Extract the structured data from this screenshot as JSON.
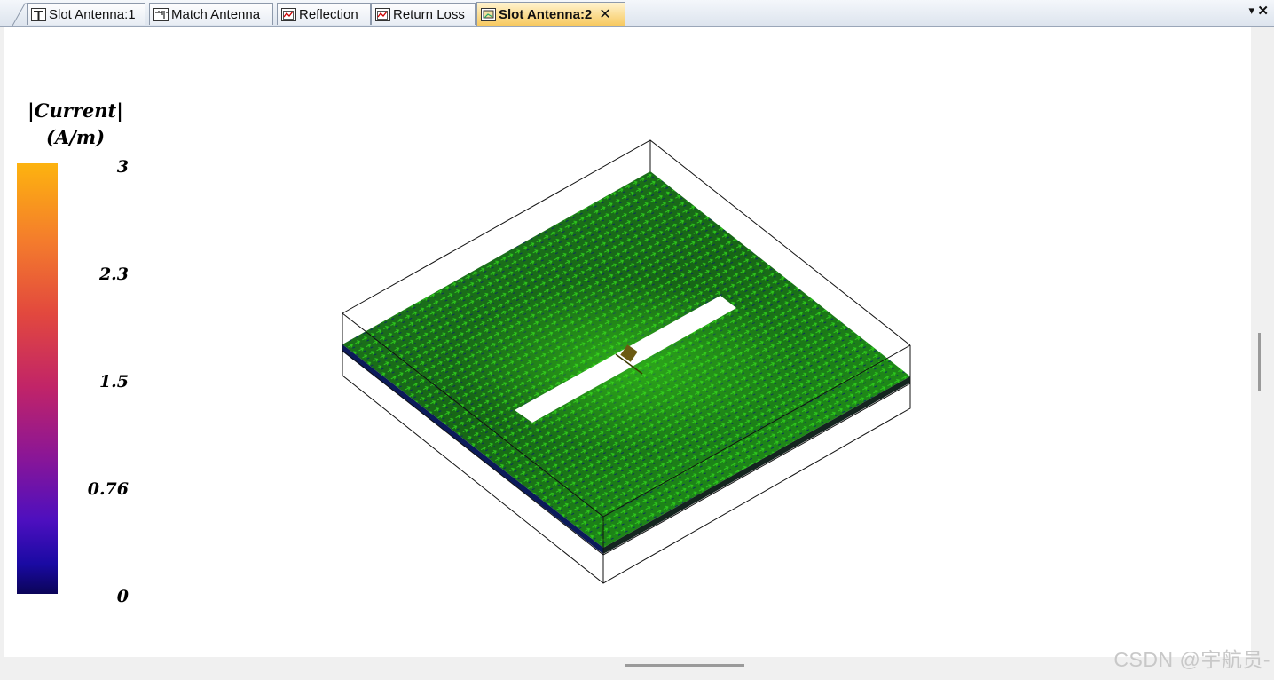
{
  "tabs": [
    {
      "label": "Slot Antenna:1",
      "icon": "layout-icon",
      "active": false
    },
    {
      "label": "Match Antenna",
      "icon": "schematic-icon",
      "active": false
    },
    {
      "label": "Reflection",
      "icon": "graph-icon",
      "active": false
    },
    {
      "label": "Return Loss",
      "icon": "graph-icon",
      "active": false
    },
    {
      "label": "Slot Antenna:2",
      "icon": "em-view-icon",
      "active": true,
      "close": "✕"
    }
  ],
  "window_controls": {
    "menu": "▾",
    "close": "✕"
  },
  "legend": {
    "title_line1": "|Current|",
    "title_line2": "(A/m)",
    "ticks": [
      "3",
      "2.3",
      "1.5",
      "0.76",
      "0"
    ],
    "colors": {
      "max": "#fdb30f",
      "min": "#0b0458",
      "vector": "#22c414"
    }
  },
  "watermark": "CSDN @宇航员-"
}
